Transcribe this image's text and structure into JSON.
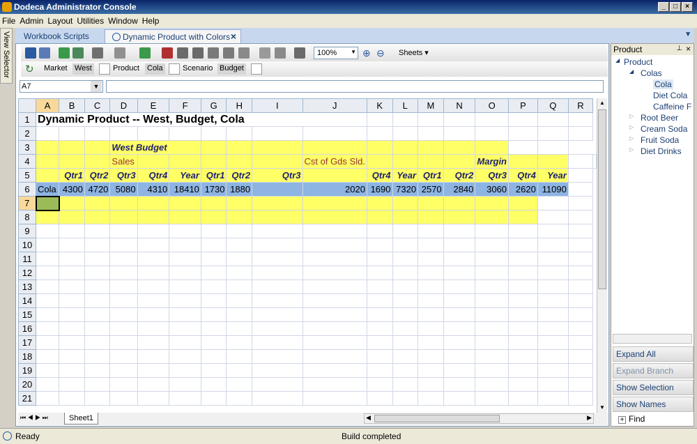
{
  "window": {
    "title": "Dodeca Administrator Console"
  },
  "menu": [
    "File",
    "Admin",
    "Layout",
    "Utilities",
    "Window",
    "Help"
  ],
  "view_selector": "View Selector",
  "tabs": [
    {
      "label": "Workbook Scripts"
    },
    {
      "label": "Dynamic Product with Colors"
    }
  ],
  "toolbar": {
    "zoom": "100%",
    "sheets": "Sheets"
  },
  "pov": {
    "market_label": "Market",
    "market_value": "West",
    "product_label": "Product",
    "product_value": "Cola",
    "scenario_label": "Scenario",
    "scenario_value": "Budget"
  },
  "namebox": "A7",
  "columns": [
    "A",
    "B",
    "C",
    "D",
    "E",
    "F",
    "G",
    "H",
    "I",
    "J",
    "K",
    "L",
    "M",
    "N",
    "O",
    "P",
    "Q",
    "R"
  ],
  "sheet": {
    "title": "Dynamic Product -- West, Budget, Cola",
    "west_budget": "West  Budget",
    "sales": "Sales",
    "cogs": "Cst of Gds Sld.",
    "margin": "Margin",
    "row5": [
      "",
      "Qtr1",
      "Qtr2",
      "Qtr3",
      "Qtr4",
      "Year",
      "Qtr1",
      "Qtr2",
      "Qtr3",
      "",
      "Qtr4",
      "Year",
      "Qtr1",
      "Qtr2",
      "Qtr3",
      "Qtr4",
      "Year"
    ],
    "row6": [
      "Cola",
      "4300",
      "4720",
      "5080",
      "4310",
      "18410",
      "1730",
      "1880",
      "",
      "2020",
      "1690",
      "7320",
      "2570",
      "2840",
      "3060",
      "2620",
      "11090"
    ]
  },
  "sheet_tab": "Sheet1",
  "right_pane": {
    "title": "Product",
    "tree": [
      "Product",
      "Colas",
      "Cola",
      "Diet Cola",
      "Caffeine F",
      "Root Beer",
      "Cream Soda",
      "Fruit Soda",
      "Diet Drinks"
    ],
    "buttons": [
      "Expand All",
      "Expand Branch",
      "Show Selection",
      "Show Names"
    ],
    "find": "Find"
  },
  "status": {
    "left": "Ready",
    "center": "Build completed"
  }
}
